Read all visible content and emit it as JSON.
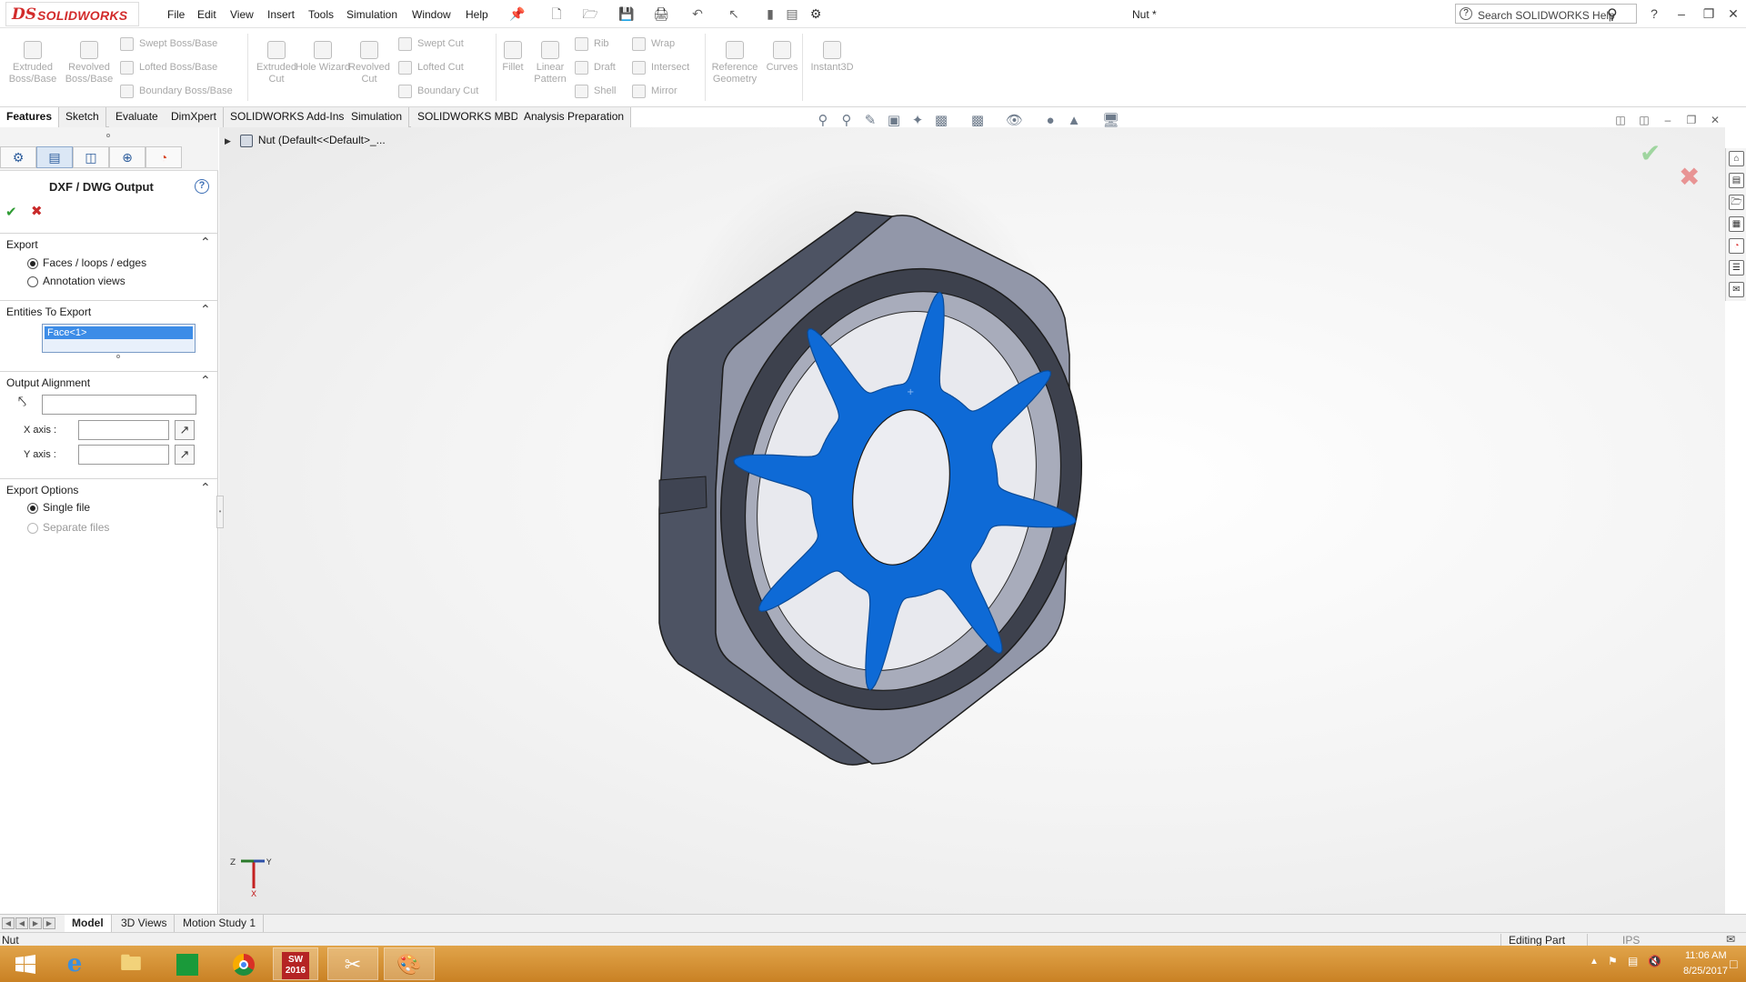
{
  "app": {
    "logo_ds": "DS",
    "logo_text": "SOLIDWORKS",
    "document_title": "Nut *",
    "search_placeholder": "Search SOLIDWORKS Help",
    "help_glyph": "?",
    "menus": [
      "File",
      "Edit",
      "View",
      "Insert",
      "Tools",
      "Simulation",
      "Window",
      "Help"
    ]
  },
  "command_manager": {
    "big_buttons": [
      {
        "label": "Extruded Boss/Base"
      },
      {
        "label": "Revolved Boss/Base"
      },
      {
        "label": "Extruded Cut"
      },
      {
        "label": "Hole Wizard"
      },
      {
        "label": "Revolved Cut"
      },
      {
        "label": "Fillet"
      },
      {
        "label": "Linear Pattern"
      },
      {
        "label": "Reference Geometry"
      },
      {
        "label": "Curves"
      },
      {
        "label": "Instant3D"
      }
    ],
    "small_buttons": [
      {
        "label": "Swept Boss/Base"
      },
      {
        "label": "Lofted Boss/Base"
      },
      {
        "label": "Boundary Boss/Base"
      },
      {
        "label": "Swept Cut"
      },
      {
        "label": "Lofted Cut"
      },
      {
        "label": "Boundary Cut"
      },
      {
        "label": "Rib"
      },
      {
        "label": "Draft"
      },
      {
        "label": "Shell"
      },
      {
        "label": "Wrap"
      },
      {
        "label": "Intersect"
      },
      {
        "label": "Mirror"
      }
    ],
    "tabs": [
      "Features",
      "Sketch",
      "Evaluate",
      "DimXpert",
      "SOLIDWORKS Add-Ins",
      "Simulation",
      "SOLIDWORKS MBD",
      "Analysis Preparation"
    ],
    "active_tab": "Features"
  },
  "property_manager": {
    "title": "DXF / DWG Output",
    "export": {
      "header": "Export",
      "options": [
        "Faces / loops / edges",
        "Annotation views"
      ],
      "selected": "Faces / loops / edges"
    },
    "entities": {
      "header": "Entities To Export",
      "items": [
        "Face<1>"
      ]
    },
    "alignment": {
      "header": "Output Alignment",
      "x_axis_label": "X axis :",
      "y_axis_label": "Y axis :",
      "origin_value": "",
      "x_axis_value": "",
      "y_axis_value": ""
    },
    "export_options": {
      "header": "Export Options",
      "options": [
        "Single file",
        "Separate files"
      ],
      "selected": "Single file"
    }
  },
  "feature_tree": {
    "root": "Nut  (Default<<Default>_..."
  },
  "triad": {
    "x": "X",
    "y": "Y",
    "z": "Z"
  },
  "model_tabs": [
    "Model",
    "3D Views",
    "Motion Study 1"
  ],
  "active_model_tab": "Model",
  "status_bar": {
    "left": "Nut",
    "mode": "Editing Part",
    "units": "IPS"
  },
  "taskbar": {
    "sw_badge": "SW",
    "sw_year": "2016",
    "time": "11:06 AM",
    "date": "8/25/2017"
  },
  "colors": {
    "accent_blue": "#0e6ad6",
    "part_gray": "#8d93a6",
    "solidworks_red": "#d22b2b",
    "taskbar_orange": "#d58f32"
  }
}
